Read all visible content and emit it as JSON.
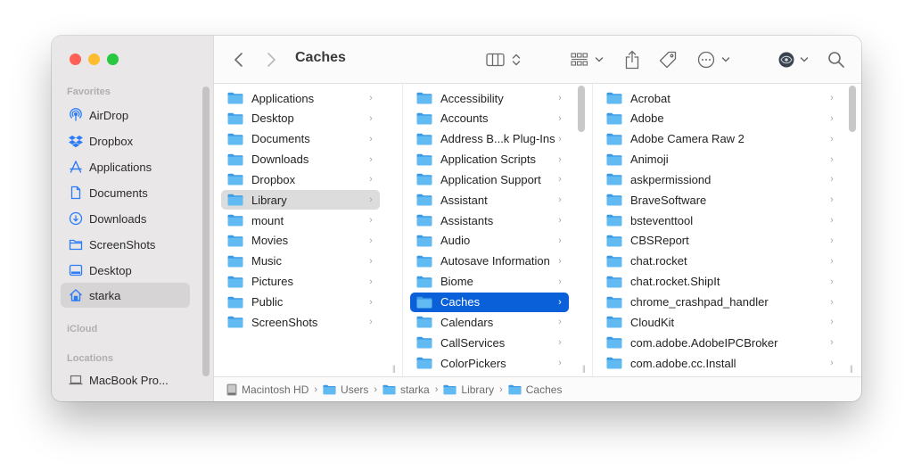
{
  "window": {
    "title": "Caches",
    "traffic_lights": [
      "close",
      "minimize",
      "zoom"
    ]
  },
  "sidebar": {
    "sections": [
      {
        "title": "Favorites",
        "items": [
          {
            "label": "AirDrop",
            "icon": "airdrop-icon"
          },
          {
            "label": "Dropbox",
            "icon": "dropbox-icon"
          },
          {
            "label": "Applications",
            "icon": "applications-icon"
          },
          {
            "label": "Documents",
            "icon": "document-icon"
          },
          {
            "label": "Downloads",
            "icon": "download-icon"
          },
          {
            "label": "ScreenShots",
            "icon": "folder-icon"
          },
          {
            "label": "Desktop",
            "icon": "desktop-icon"
          },
          {
            "label": "starka",
            "icon": "home-icon",
            "selected": true
          }
        ]
      },
      {
        "title": "iCloud",
        "items": []
      },
      {
        "title": "Locations",
        "items": [
          {
            "label": "MacBook Pro...",
            "icon": "laptop-icon"
          }
        ]
      }
    ]
  },
  "toolbar": {
    "back_icon": "chevron-left-icon",
    "forward_icon": "chevron-right-icon",
    "title": "Caches",
    "view_mode": "columns",
    "buttons": [
      "view-columns",
      "group",
      "share",
      "tags",
      "more-actions",
      "preview",
      "search"
    ]
  },
  "columns": [
    {
      "name": "starka",
      "items": [
        "Applications",
        "Desktop",
        "Documents",
        "Downloads",
        "Dropbox",
        "Library",
        "mount",
        "Movies",
        "Music",
        "Pictures",
        "Public",
        "ScreenShots"
      ],
      "selected": "Library"
    },
    {
      "name": "Library",
      "items": [
        "Accessibility",
        "Accounts",
        "Address B...k Plug-Ins",
        "Application Scripts",
        "Application Support",
        "Assistant",
        "Assistants",
        "Audio",
        "Autosave Information",
        "Biome",
        "Caches",
        "Calendars",
        "CallServices",
        "ColorPickers"
      ],
      "selected": "Caches"
    },
    {
      "name": "Caches",
      "items": [
        "Acrobat",
        "Adobe",
        "Adobe Camera Raw 2",
        "Animoji",
        "askpermissiond",
        "BraveSoftware",
        "bsteventtool",
        "CBSReport",
        "chat.rocket",
        "chat.rocket.ShipIt",
        "chrome_crashpad_handler",
        "CloudKit",
        "com.adobe.AdobeIPCBroker",
        "com.adobe.cc.Install"
      ],
      "selected": null
    }
  ],
  "pathbar": {
    "segments": [
      "Macintosh HD",
      "Users",
      "starka",
      "Library",
      "Caches"
    ],
    "separator": "›"
  },
  "colors": {
    "accent": "#0a60d8",
    "folder": "#5db3f0",
    "sidebar_bg": "#e9e7e8",
    "sidebar_icon": "#2d7cf6"
  }
}
